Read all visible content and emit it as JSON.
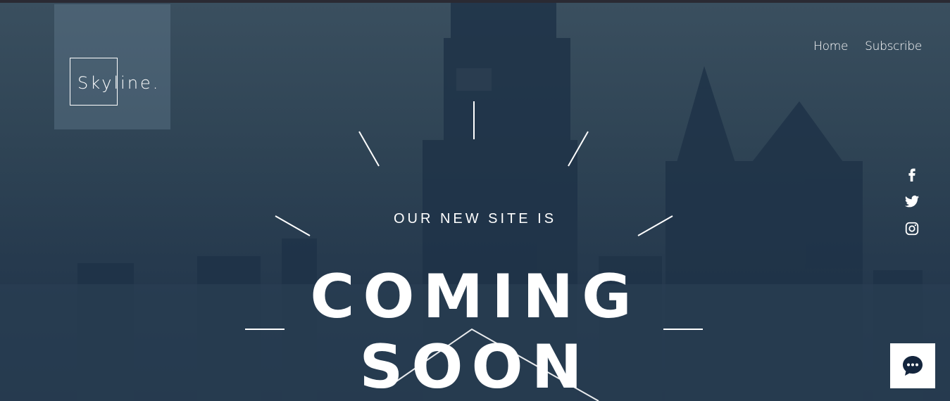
{
  "brand": {
    "name": "Skyline."
  },
  "nav": {
    "items": [
      {
        "label": "Home"
      },
      {
        "label": "Subscribe"
      }
    ]
  },
  "hero": {
    "tagline": "OUR NEW SITE IS",
    "headline_line1": "COMING",
    "headline_line2": "SOON"
  },
  "social": {
    "icons": [
      "facebook-icon",
      "twitter-icon",
      "instagram-icon"
    ]
  },
  "chat": {
    "icon": "chat-bubble-icon"
  },
  "colors": {
    "overlay": "#263a4e",
    "logo_panel": "#5f7a8f",
    "text": "#ffffff",
    "chat_button": "#ffffff",
    "chat_icon": "#14253d"
  }
}
